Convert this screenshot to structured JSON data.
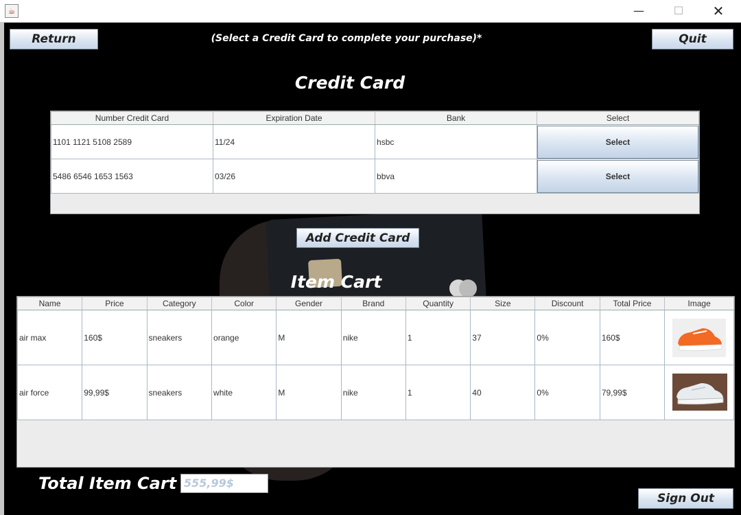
{
  "window": {
    "minimize": "—",
    "maximize": "☐",
    "close": "✕"
  },
  "toolbar": {
    "return_label": "Return",
    "instruction": "(Select a Credit Card to complete your purchase)*",
    "quit_label": "Quit"
  },
  "credit_section": {
    "title": "Credit Card",
    "headers": [
      "Number Credit Card",
      "Expiration Date",
      "Bank",
      "Select"
    ],
    "rows": [
      {
        "number": "1101 1121 5108 2589",
        "expiration": "11/24",
        "bank": "hsbc",
        "select": "Select"
      },
      {
        "number": "5486 6546 1653 1563",
        "expiration": "03/26",
        "bank": "bbva",
        "select": "Select"
      }
    ],
    "add_label": "Add Credit Card"
  },
  "cart_section": {
    "title": "Item Cart",
    "headers": [
      "Name",
      "Price",
      "Category",
      "Color",
      "Gender",
      "Brand",
      "Quantity",
      "Size",
      "Discount",
      "Total Price",
      "Image"
    ],
    "rows": [
      {
        "name": "air max",
        "price": "160$",
        "category": "sneakers",
        "color": "orange",
        "gender": "M",
        "brand": "nike",
        "quantity": "1",
        "size": "37",
        "discount": "0%",
        "total": "160$",
        "image": "orange-sneaker-image"
      },
      {
        "name": "air force",
        "price": "99,99$",
        "category": "sneakers",
        "color": "white",
        "gender": "M",
        "brand": "nike",
        "quantity": "1",
        "size": "40",
        "discount": "0%",
        "total": "79,99$",
        "image": "white-sneaker-image"
      }
    ]
  },
  "footer": {
    "total_label": "Total Item Cart :",
    "total_value": "555,99$",
    "sign_out_label": "Sign Out"
  },
  "colors": {
    "background": "#000000",
    "button_gradient_end": "#c9d7ea",
    "heading": "#ffffff"
  }
}
